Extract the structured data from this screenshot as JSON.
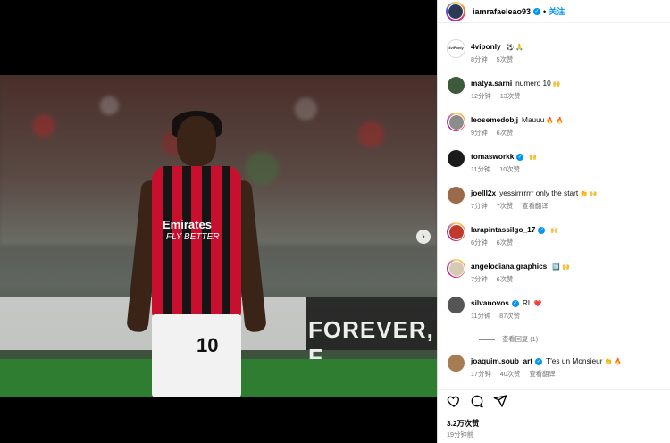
{
  "header": {
    "username": "iamrafaeleao93",
    "dot": "•",
    "follow_label": "关注"
  },
  "photo": {
    "sponsor_line1": "Emirates",
    "sponsor_line2": "FLY BETTER",
    "shorts_number": "10",
    "ad_text": "FOREVER, F",
    "next_glyph": "›"
  },
  "comments": [
    {
      "user": "4viponly",
      "text": "",
      "emoji": [
        "⚽",
        "🙏"
      ],
      "verified": false,
      "time": "8分钟",
      "likes": "5次赞",
      "translate": "",
      "avatar_color": "#ffffff",
      "avatar_label": "4viPonly",
      "ring": false
    },
    {
      "user": "matya.sarni",
      "text": "numero 10",
      "emoji": [
        "🙌"
      ],
      "verified": false,
      "time": "12分钟",
      "likes": "13次赞",
      "translate": "",
      "avatar_color": "#3d5a3b",
      "ring": false
    },
    {
      "user": "leosemedobjj",
      "text": "Mauuu",
      "emoji": [
        "🔥",
        "🔥"
      ],
      "verified": false,
      "time": "9分钟",
      "likes": "6次赞",
      "translate": "",
      "avatar_color": "#8c8c8c",
      "ring": true
    },
    {
      "user": "tomasworkk",
      "text": "",
      "emoji": [
        "🙌"
      ],
      "verified": true,
      "time": "11分钟",
      "likes": "10次赞",
      "translate": "",
      "avatar_color": "#1a1a1a",
      "ring": false
    },
    {
      "user": "joelll2x",
      "text": "yessirrrrrrr only the start",
      "emoji": [
        "👏",
        "🙌"
      ],
      "verified": false,
      "time": "7分钟",
      "likes": "7次赞",
      "translate": "查看翻译",
      "avatar_color": "#9a6b4a",
      "ring": false
    },
    {
      "user": "larapintassilgo_17",
      "text": "",
      "emoji": [
        "🙌"
      ],
      "verified": true,
      "time": "6分钟",
      "likes": "6次赞",
      "translate": "",
      "avatar_color": "#c0392b",
      "ring": true
    },
    {
      "user": "angelodiana.graphics",
      "text": "",
      "emoji": [
        "🔟",
        "🙌"
      ],
      "verified": false,
      "time": "7分钟",
      "likes": "6次赞",
      "translate": "",
      "avatar_color": "#d7c9b3",
      "ring": true
    },
    {
      "user": "silvanovos",
      "text": "RL",
      "emoji": [
        "❤️"
      ],
      "verified": true,
      "time": "11分钟",
      "likes": "87次赞",
      "translate": "",
      "avatar_color": "#555555",
      "ring": false
    }
  ],
  "view_replies": "查看回复 (1)",
  "last_comment": {
    "user": "joaquim.soub_art",
    "text": "T'es un Monsieur",
    "emoji": [
      "👏",
      "🔥"
    ],
    "verified": true,
    "time": "17分钟",
    "likes": "40次赞",
    "translate": "查看翻译",
    "avatar_color": "#a67c52"
  },
  "footer": {
    "likes": "3.2万次赞",
    "time": "19分钟前"
  }
}
